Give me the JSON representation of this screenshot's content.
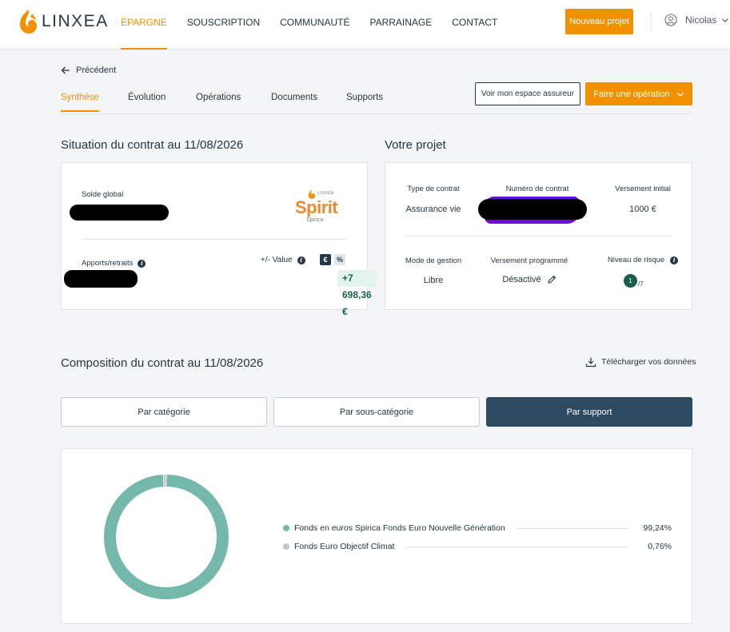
{
  "header": {
    "logo_text": "LINXEA",
    "nav": [
      "Épargne",
      "Souscription",
      "Communauté",
      "Parrainage",
      "Contact"
    ],
    "new_project_label": "Nouveau projet",
    "user_name": "Nicolas"
  },
  "subnav": {
    "back_label": "Précédent",
    "tabs": [
      "Synthèse",
      "Évolution",
      "Opérations",
      "Documents",
      "Supports"
    ],
    "insurer_button": "Voir mon espace assureur",
    "operation_button": "Faire une opération"
  },
  "situation": {
    "title": "Situation du contrat au 11/08/2026",
    "solde_label": "Solde global",
    "apports_label": "Apports/retraits",
    "value_label": "+/- Value",
    "unit_euro": "€",
    "unit_pct": "%",
    "value_amount": "+7 698,36 €",
    "brand_name": "Spirit",
    "brand_sub": "Spirica",
    "brand_top": "LINXEA"
  },
  "project": {
    "title": "Votre projet",
    "type_label": "Type de contrat",
    "type_value": "Assurance vie",
    "numero_label": "Numéro de contrat",
    "versement_initial_label": "Versement initial",
    "versement_initial_value": "1000 €",
    "mode_label": "Mode de gestion",
    "mode_value": "Libre",
    "programme_label": "Versement programmé",
    "programme_value": "Désactivé",
    "risque_label": "Niveau de risque",
    "risque_value": "1",
    "risque_max": "/7"
  },
  "composition": {
    "title": "Composition du contrat au 11/08/2026",
    "download_label": "Télécharger vos données",
    "segments": [
      "Par catégorie",
      "Par sous-catégorie",
      "Par support"
    ],
    "active_segment": 2
  },
  "chart_data": {
    "type": "pie",
    "donut": true,
    "labels": [
      "Fonds en euros Spirica Fonds Euro Nouvelle Génération",
      "Fonds Euro Objectif Climat"
    ],
    "values": [
      99.24,
      0.76
    ],
    "display_values": [
      "99,24%",
      "0,76%"
    ],
    "colors": [
      "#74b8ac",
      "#c3c6d6"
    ]
  },
  "colors": {
    "accent": "#f29100",
    "navy": "#243746",
    "active_segment_bg": "#2e4a60",
    "value_chip_bg": "#e3f3ee",
    "risk_badge": "#1b5e4e",
    "redaction_purple": "#6a0dd9"
  }
}
